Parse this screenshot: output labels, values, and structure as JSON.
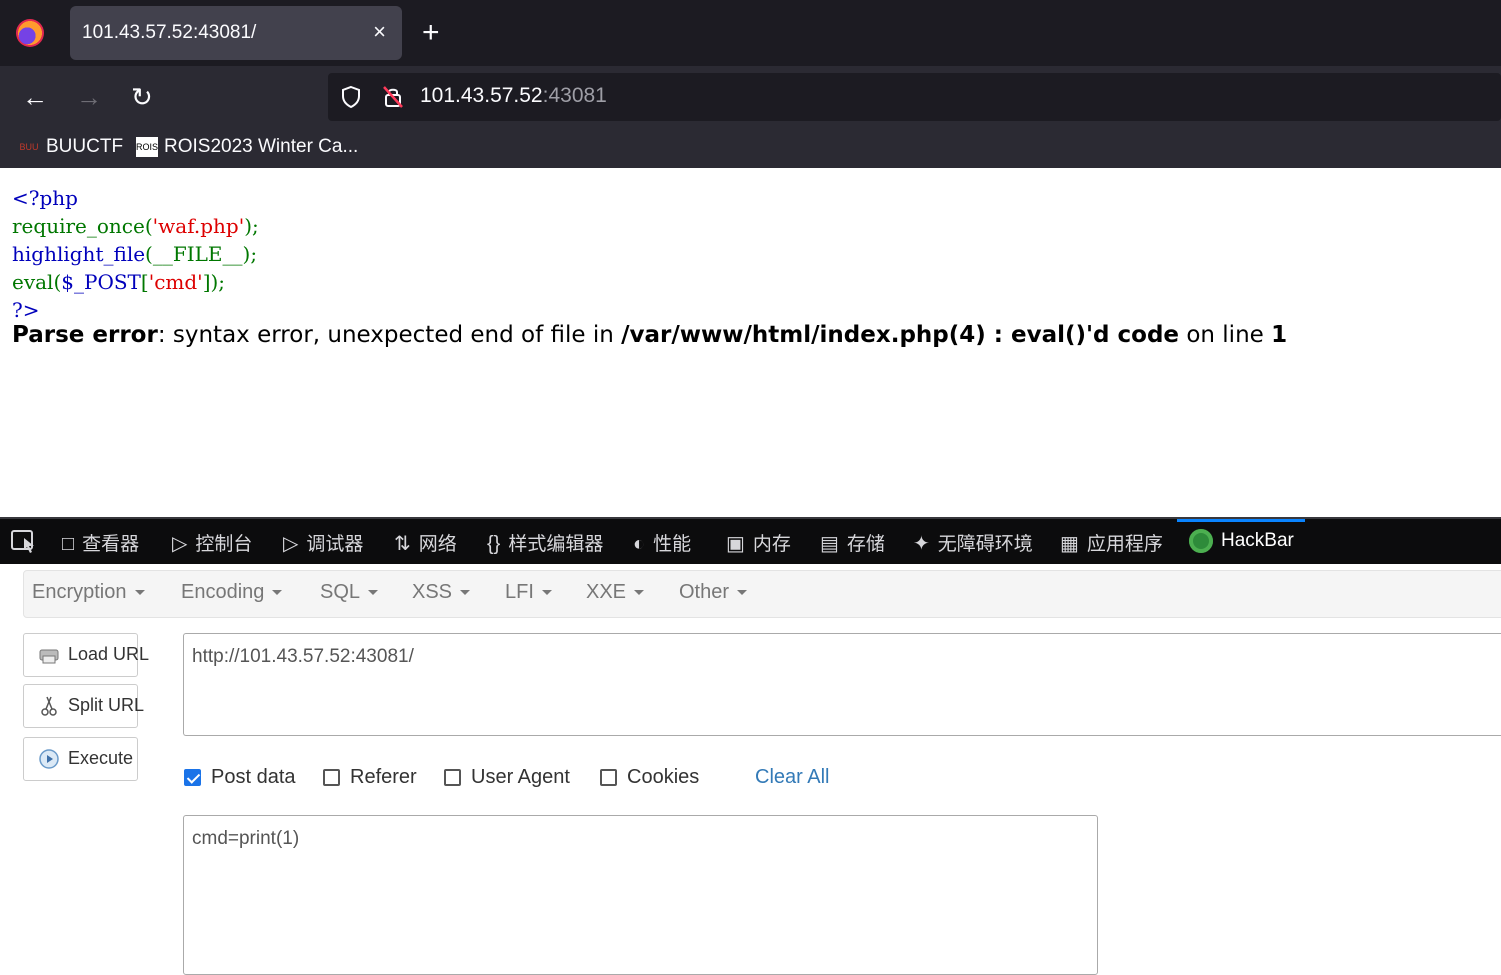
{
  "browser": {
    "tab_title": "101.43.57.52:43081/",
    "tab_close": "×",
    "new_tab": "+",
    "url_host": "101.43.57.52",
    "url_port": ":43081",
    "bookmarks": [
      {
        "label": "BUUCTF",
        "icon_text": "BUU"
      },
      {
        "label": "ROIS2023 Winter Ca...",
        "icon_text": "ROIS"
      }
    ]
  },
  "page": {
    "code": {
      "line1": "<?php",
      "line2_fn": "require_once",
      "line2_open": "(",
      "line2_str": "'waf.php'",
      "line2_close": ");",
      "line3_fn": "highlight_file",
      "line3_arg": "(__FILE__",
      "line3_close": ");",
      "line4_fn": "eval",
      "line4_open": "(",
      "line4_var": "$_POST",
      "line4_br": "[",
      "line4_str": "'cmd'",
      "line4_close": "]);",
      "line5": "?>"
    },
    "error": {
      "label": "Parse error",
      "message": ": syntax error, unexpected end of file in ",
      "file": "/var/www/html/index.php(4) : eval()'d code",
      "on_line": " on line ",
      "line": "1"
    }
  },
  "devtools": {
    "tabs": [
      "查看器",
      "控制台",
      "调试器",
      "网络",
      "样式编辑器",
      "性能",
      "内存",
      "存储",
      "无障碍环境",
      "应用程序"
    ],
    "active_tab": "HackBar"
  },
  "hackbar": {
    "menu": [
      "Encryption",
      "Encoding",
      "SQL",
      "XSS",
      "LFI",
      "XXE",
      "Other"
    ],
    "load_url": "Load URL",
    "split_url": "Split URL",
    "execute": "Execute",
    "url_value": "http://101.43.57.52:43081/",
    "options": {
      "post_data": "Post data",
      "referer": "Referer",
      "user_agent": "User Agent",
      "cookies": "Cookies"
    },
    "post_data_checked": true,
    "clear_all": "Clear All",
    "post_value": "cmd=print(1)"
  }
}
